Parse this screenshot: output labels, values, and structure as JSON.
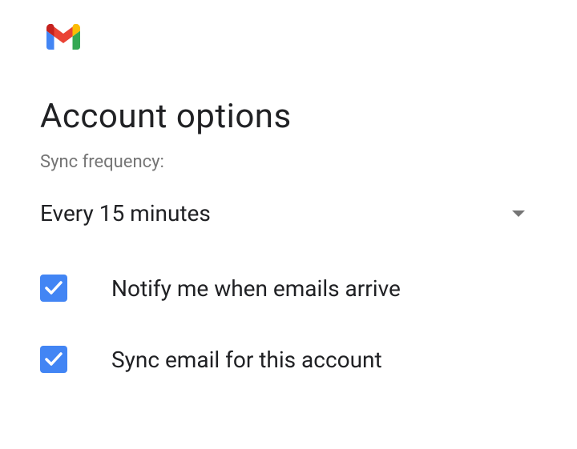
{
  "title": "Account options",
  "sync_frequency": {
    "label": "Sync frequency:",
    "value": "Every 15 minutes"
  },
  "options": {
    "notify": {
      "label": "Notify me when emails arrive",
      "checked": true
    },
    "sync": {
      "label": "Sync email for this account",
      "checked": true
    }
  }
}
